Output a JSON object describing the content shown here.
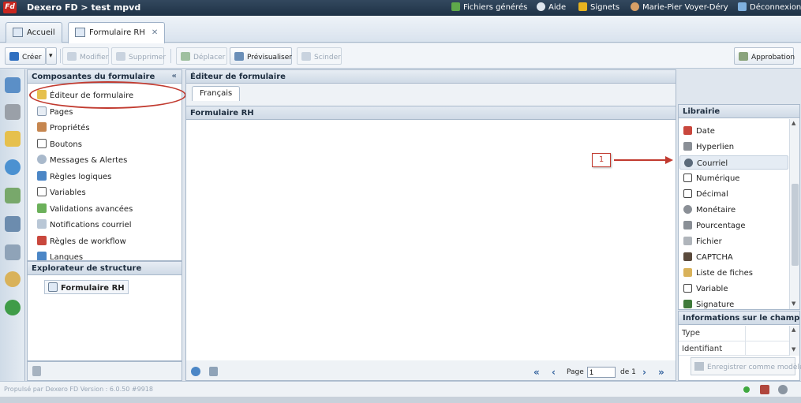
{
  "topbar": {
    "logo": "Fd",
    "title": "Dexero FD > test mpvd",
    "links": {
      "generated_files": "Fichiers générés",
      "help": "Aide",
      "bookmarks": "Signets",
      "user": "Marie-Pier Voyer-Déry",
      "logout": "Déconnexion"
    }
  },
  "tabs": {
    "home": "Accueil",
    "form": "Formulaire RH",
    "close": "✕"
  },
  "toolbar": {
    "create": "Créer",
    "modify": "Modifier",
    "delete": "Supprimer",
    "move": "Déplacer",
    "preview": "Prévisualiser",
    "split": "Scinder",
    "approval": "Approbation"
  },
  "components": {
    "title": "Composantes du formulaire",
    "collapse": "«",
    "items": [
      "Éditeur de formulaire",
      "Pages",
      "Propriétés",
      "Boutons",
      "Messages & Alertes",
      "Règles logiques",
      "Variables",
      "Validations avancées",
      "Notifications courriel",
      "Règles de workflow",
      "Langues"
    ]
  },
  "explorer": {
    "title": "Explorateur de structure",
    "item": "Formulaire RH"
  },
  "editor": {
    "title": "Éditeur de formulaire",
    "lang_tab": "Français",
    "form_title": "Formulaire RH",
    "pager": {
      "page_label": "Page",
      "page_value": "1",
      "of_label": "de 1"
    }
  },
  "library": {
    "title": "Librairie",
    "items": [
      "Date",
      "Hyperlien",
      "Courriel",
      "Numérique",
      "Décimal",
      "Monétaire",
      "Pourcentage",
      "Fichier",
      "CAPTCHA",
      "Liste de fiches",
      "Variable",
      "Signature"
    ],
    "selected": "Courriel"
  },
  "fieldinfo": {
    "title": "Informations sur le champ",
    "type_label": "Type",
    "id_label": "Identifiant",
    "save_model": "Enregistrer comme modèle"
  },
  "callout": {
    "number": "1"
  },
  "status": {
    "version": "Propulsé par Dexero FD Version : 6.0.50 #9918"
  },
  "colors": {
    "accent_red": "#c13a2f",
    "header_dark": "#1f3246",
    "panel_border": "#a9b9cb"
  }
}
